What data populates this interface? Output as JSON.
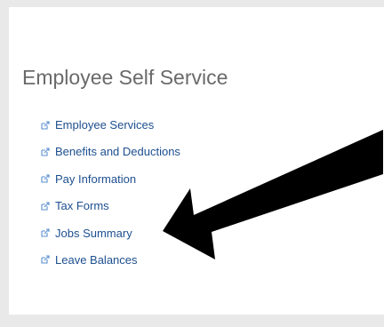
{
  "section": {
    "title": "Employee Self Service"
  },
  "links": [
    {
      "label": "Employee Services",
      "icon": "external-link-icon"
    },
    {
      "label": "Benefits and Deductions",
      "icon": "external-link-icon"
    },
    {
      "label": "Pay Information",
      "icon": "external-link-icon"
    },
    {
      "label": "Tax Forms",
      "icon": "external-link-icon"
    },
    {
      "label": "Jobs Summary",
      "icon": "external-link-icon"
    },
    {
      "label": "Leave Balances",
      "icon": "external-link-icon"
    }
  ],
  "annotation": {
    "type": "arrow",
    "points_to": "Jobs Summary",
    "color": "#000000"
  },
  "colors": {
    "link": "#1d4f8f",
    "title": "#6a6a6a",
    "background": "#e9e9e9",
    "card": "#ffffff"
  }
}
